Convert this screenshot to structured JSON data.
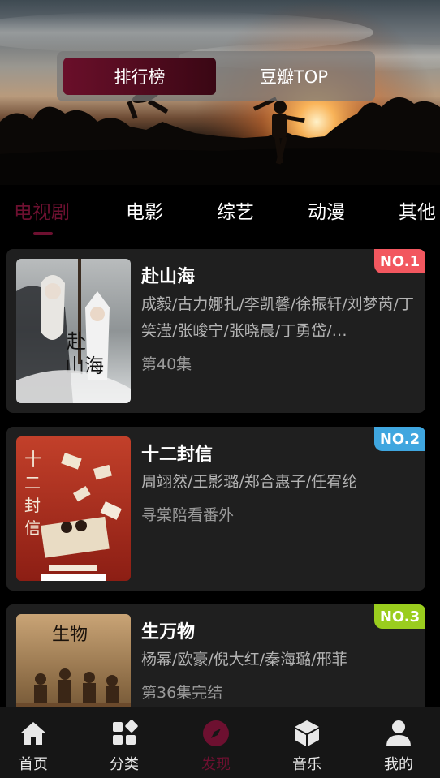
{
  "banner": {
    "segments": [
      {
        "label": "排行榜",
        "active": true
      },
      {
        "label": "豆瓣TOP",
        "active": false
      }
    ]
  },
  "tabs": [
    {
      "label": "电视剧",
      "active": true
    },
    {
      "label": "电影",
      "active": false
    },
    {
      "label": "综艺",
      "active": false
    },
    {
      "label": "动漫",
      "active": false
    },
    {
      "label": "其他",
      "active": false
    }
  ],
  "rankings": [
    {
      "rank": "NO.1",
      "badge_color": "#f2575f",
      "title": "赴山海",
      "cast": "成毅/古力娜扎/李凯馨/徐振轩/刘梦芮/丁笑滢/张峻宁/张晓晨/丁勇岱/…",
      "status": "第40集"
    },
    {
      "rank": "NO.2",
      "badge_color": "#3fa6df",
      "title": "十二封信",
      "cast": "周翊然/王影璐/郑合惠子/任宥纶",
      "status": "寻棠陪看番外"
    },
    {
      "rank": "NO.3",
      "badge_color": "#9acd1e",
      "title": "生万物",
      "cast": "杨幂/欧豪/倪大红/秦海璐/邢菲",
      "status": "第36集完结"
    }
  ],
  "bottom_nav": [
    {
      "label": "首页",
      "icon": "home-icon",
      "active": false
    },
    {
      "label": "分类",
      "icon": "category-icon",
      "active": false
    },
    {
      "label": "发现",
      "icon": "compass-icon",
      "active": true
    },
    {
      "label": "音乐",
      "icon": "cube-icon",
      "active": false
    },
    {
      "label": "我的",
      "icon": "user-icon",
      "active": false
    }
  ],
  "colors": {
    "accent": "#6d1030",
    "background": "#000000",
    "card": "#1f1f1f",
    "nav_background": "#161616"
  }
}
